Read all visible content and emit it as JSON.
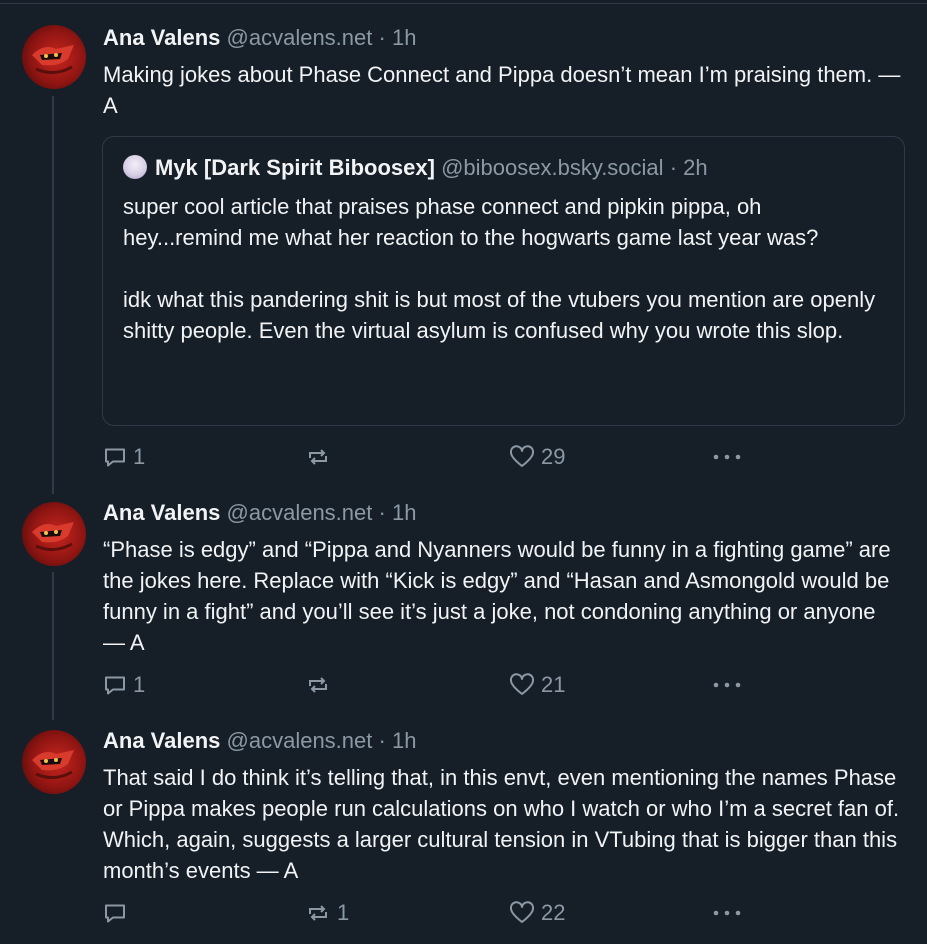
{
  "posts": [
    {
      "author": "Ana Valens",
      "handle": "@acvalens.net",
      "separator": "·",
      "time": "1h",
      "text": "Making jokes about Phase Connect and Pippa doesn’t mean I’m praising them. — A",
      "quote": {
        "author": "Myk [Dark Spirit Biboosex]",
        "handle": "@biboosex.bsky.social",
        "separator": "·",
        "time": "2h",
        "text": "super cool article that praises phase connect and pipkin pippa, oh hey...remind me what her reaction to the hogwarts game last year was?\n\nidk what this pandering shit is but most of the vtubers you mention are openly shitty people. Even the virtual asylum is confused why you wrote this slop."
      },
      "replies": "1",
      "reposts": "",
      "likes": "29"
    },
    {
      "author": "Ana Valens",
      "handle": "@acvalens.net",
      "separator": "·",
      "time": "1h",
      "text": "“Phase is edgy” and “Pippa and Nyanners would be funny in a fighting game” are the jokes here. Replace with “Kick is edgy” and “Hasan and Asmongold would be funny in a fight” and you’ll see it’s just a joke, not condoning anything or anyone — A",
      "replies": "1",
      "reposts": "",
      "likes": "21"
    },
    {
      "author": "Ana Valens",
      "handle": "@acvalens.net",
      "separator": "·",
      "time": "1h",
      "text": "That said I do think it’s telling that, in this envt, even mentioning the names Phase or Pippa makes people run calculations on who I watch or who I’m a secret fan of. Which, again, suggests a larger cultural tension in VTubing that is bigger than this month’s events — A",
      "replies": "",
      "reposts": "1",
      "likes": "22"
    }
  ],
  "icons": {
    "reply": "speech-bubble-icon",
    "repost": "repost-arrows-icon",
    "like": "heart-icon",
    "more": "ellipsis-icon"
  },
  "colors": {
    "background": "#161e27",
    "text": "#f1f3f5",
    "muted": "#8b98a5",
    "border": "#2e3a47",
    "avatar": "#c8261f"
  }
}
